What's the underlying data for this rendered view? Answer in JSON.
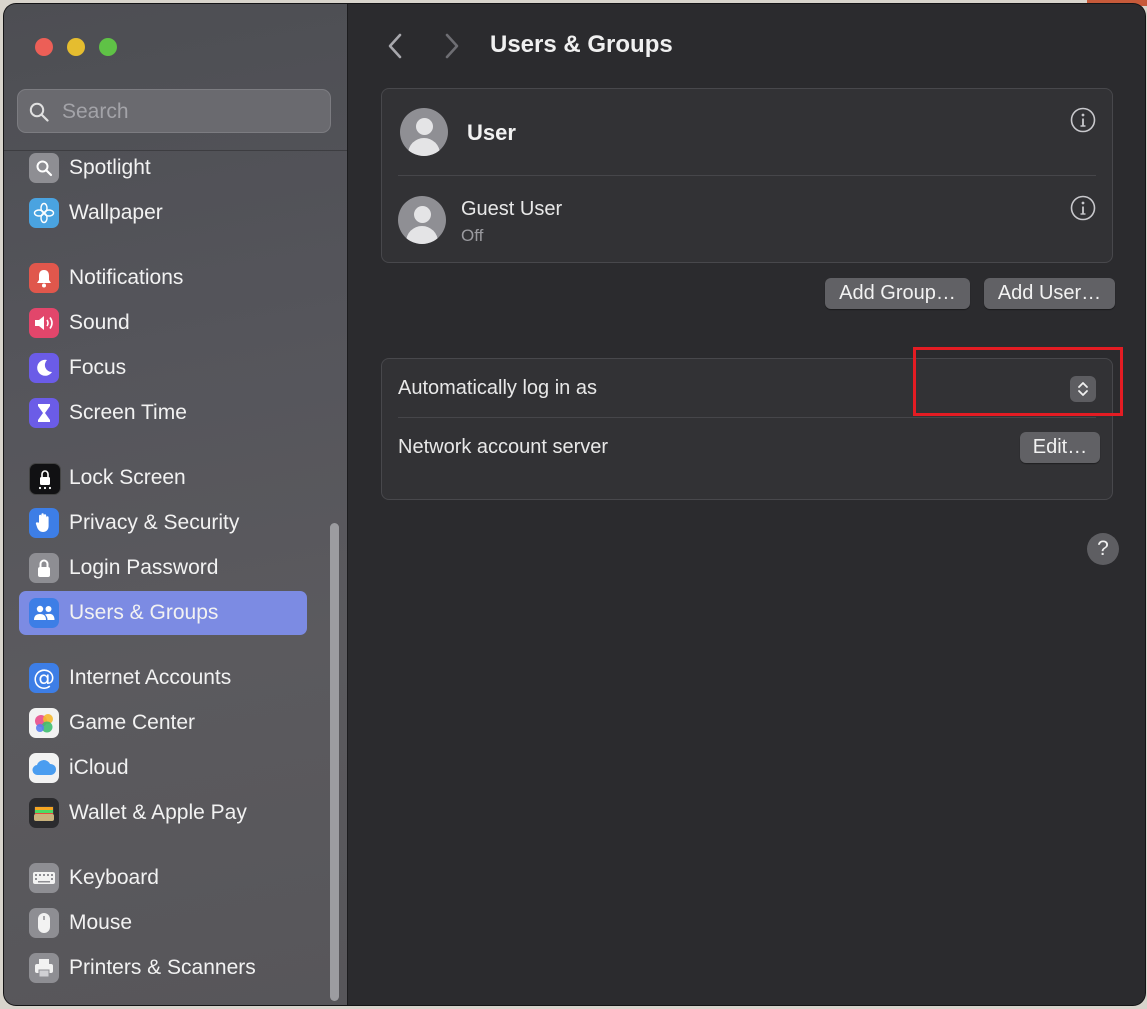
{
  "sidebar": {
    "search_placeholder": "Search",
    "items": [
      {
        "label": "Spotlight",
        "icon": "magnifier-icon",
        "color": "#8e8e93"
      },
      {
        "label": "Wallpaper",
        "icon": "flower-icon",
        "color": "#4aa3e0"
      },
      {
        "label": "Notifications",
        "icon": "bell-icon",
        "color": "#e0574c"
      },
      {
        "label": "Sound",
        "icon": "speaker-icon",
        "color": "#e2466b"
      },
      {
        "label": "Focus",
        "icon": "moon-icon",
        "color": "#6b5ce7"
      },
      {
        "label": "Screen Time",
        "icon": "hourglass-icon",
        "color": "#6b5ce7"
      },
      {
        "label": "Lock Screen",
        "icon": "lock-screen-icon",
        "color": "#1c1c1e"
      },
      {
        "label": "Privacy & Security",
        "icon": "hand-icon",
        "color": "#3d7ee6"
      },
      {
        "label": "Login Password",
        "icon": "padlock-icon",
        "color": "#8e8e93"
      },
      {
        "label": "Users & Groups",
        "icon": "users-icon",
        "color": "#3d7ee6",
        "selected": true
      },
      {
        "label": "Internet Accounts",
        "icon": "at-icon",
        "color": "#3d7ee6"
      },
      {
        "label": "Game Center",
        "icon": "game-center-icon",
        "color": "#f2f2f2"
      },
      {
        "label": "iCloud",
        "icon": "cloud-icon",
        "color": "#f2f2f2"
      },
      {
        "label": "Wallet & Apple Pay",
        "icon": "wallet-icon",
        "color": "#2b2b2e"
      },
      {
        "label": "Keyboard",
        "icon": "keyboard-icon",
        "color": "#8e8e93"
      },
      {
        "label": "Mouse",
        "icon": "mouse-icon",
        "color": "#8e8e93"
      },
      {
        "label": "Printers & Scanners",
        "icon": "printer-icon",
        "color": "#8e8e93"
      }
    ]
  },
  "header": {
    "title": "Users & Groups"
  },
  "users": {
    "current_user": {
      "name": "User"
    },
    "guest_user": {
      "name": "Guest User",
      "status": "Off"
    }
  },
  "actions": {
    "add_group": "Add Group…",
    "add_user": "Add User…"
  },
  "settings": {
    "auto_login_label": "Automatically log in as",
    "auto_login_value": "",
    "network_server_label": "Network account server",
    "edit_button": "Edit…"
  },
  "help": {
    "label": "?"
  },
  "colors": {
    "accent_selected": "#7c8be3",
    "highlight_box": "#e41c23"
  }
}
